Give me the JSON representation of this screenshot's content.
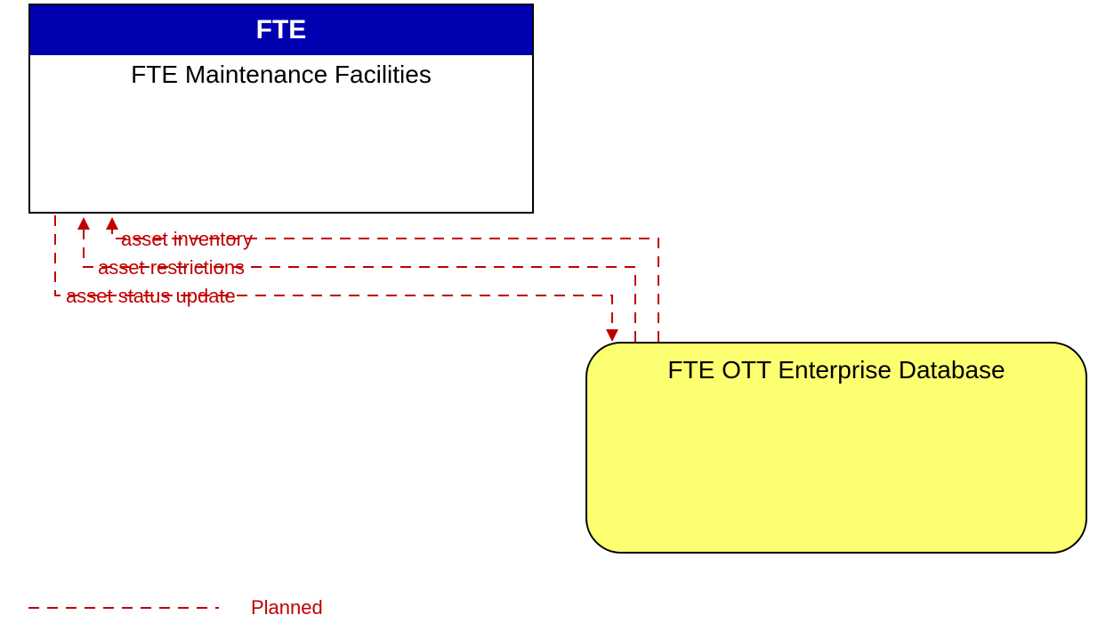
{
  "topbox": {
    "header": "FTE",
    "title": "FTE Maintenance Facilities"
  },
  "bottombox": {
    "title": "FTE OTT Enterprise Database"
  },
  "connectors": {
    "label1": "asset inventory",
    "label2": "asset restrictions",
    "label3": "asset status update"
  },
  "legend": {
    "label": "Planned"
  },
  "colors": {
    "header_bg": "#0000b0",
    "bottom_bg": "#fcff70",
    "line": "#c00000"
  }
}
